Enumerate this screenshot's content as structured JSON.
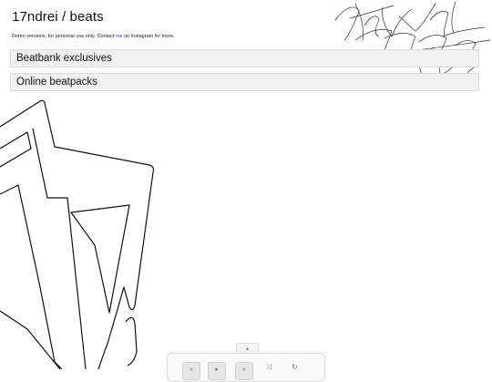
{
  "header": {
    "title": "17ndrei / beats",
    "subtitle_before": "Demo versions, for personal use only. Contact",
    "contact_link": "me",
    "subtitle_after": "on Instagram for more."
  },
  "sections": [
    {
      "label": "Beatbank exclusives"
    },
    {
      "label": "Online beatpacks"
    }
  ],
  "decoration": {
    "signature_text": "That What That Feeling Is"
  },
  "player": {
    "handle_glyph": "▲",
    "prev_glyph": "«",
    "play_glyph": "▸",
    "next_glyph": "»",
    "shuffle_glyph": "⤨",
    "repeat_glyph": "↻"
  }
}
